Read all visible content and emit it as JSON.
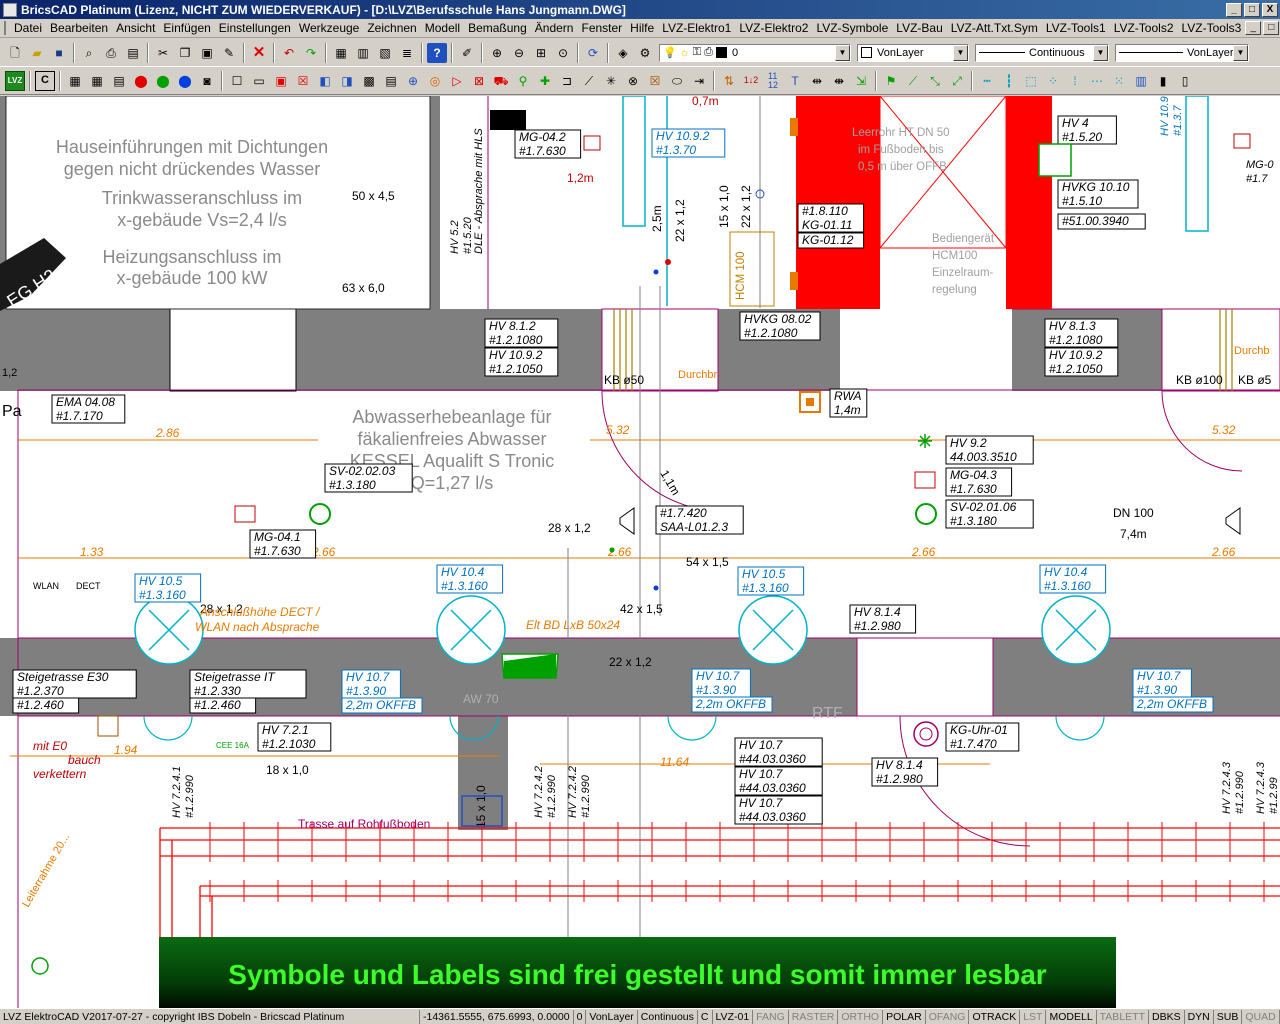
{
  "window": {
    "title": "BricsCAD Platinum (Lizenz, NICHT ZUM WIEDERVERKAUF) - [D:\\LVZ\\Berufsschule Hans Jungmann.DWG]",
    "min": "_",
    "max": "□",
    "close": "X"
  },
  "menu": [
    "Datei",
    "Bearbeiten",
    "Ansicht",
    "Einfügen",
    "Einstellungen",
    "Werkzeuge",
    "Zeichnen",
    "Modell",
    "Bemaßung",
    "Ändern",
    "Fenster",
    "Hilfe",
    "LVZ-Elektro1",
    "LVZ-Elektro2",
    "LVZ-Symbole",
    "LVZ-Bau",
    "LVZ-Att.Txt.Sym",
    "LVZ-Tools1",
    "LVZ-Tools2",
    "LVZ-Tools3"
  ],
  "properties": {
    "layer": "0",
    "color": "VonLayer",
    "linetype": "Continuous",
    "lineweight": "VonLayer"
  },
  "toolbar2": {
    "lvz_label": "LVZ",
    "c_label": "C"
  },
  "drawing": {
    "notes": [
      "Hauseinführungen mit Dichtungen",
      "gegen nicht drückendes Wasser",
      "Trinkwasseranschluss im",
      "x-gebäude Vs=2,4 l/s",
      "Heizungsanschluss  im",
      "x-gebäude 100 kW",
      "Abwasserhebeanlage für",
      "fäkalienfreies Abwasser",
      "KESSEL Aqualift S Tronic",
      "Q=1,27 l/s"
    ],
    "dims": [
      "50 x 4,5",
      "63 x 6,0",
      "2.86",
      "1.33",
      "2.66",
      "5.32",
      "28 x 1,2",
      "54 x 1,5",
      "42 x 1,5",
      "22 x 1,2",
      "18 x 1,0",
      "1.94",
      "11.64",
      "0,7m",
      "1,2m",
      "2,5m",
      "22 x 1,2",
      "15 x 1,0",
      "22 x 1,2",
      "1,1m",
      "DN 100",
      "7,4m",
      "15 x 1,0"
    ],
    "labels": [
      {
        "l1": "MG-04.2",
        "l2": "#1.7.630"
      },
      {
        "l1": "HV 10.9.2",
        "l2": "#1.3.70"
      },
      {
        "l1": "HV 4",
        "l2": "#1.5.20"
      },
      {
        "l1": "HVKG 10.10",
        "l2": "#1.5.10"
      },
      {
        "l1": "#51.00.3940",
        "l2": ""
      },
      {
        "l1": "#1.8.110",
        "l2": "KG-01.11"
      },
      {
        "l1": "KG-01.12",
        "l2": ""
      },
      {
        "l1": "HV 8.1.2",
        "l2": "#1.2.1080"
      },
      {
        "l1": "HV 10.9.2",
        "l2": "#1.2.1050"
      },
      {
        "l1": "HVKG 08.02",
        "l2": "#1.2.1080"
      },
      {
        "l1": "HV 8.1.3",
        "l2": "#1.2.1080"
      },
      {
        "l1": "HV 10.9.2",
        "l2": "#1.2.1050"
      },
      {
        "l1": "EMA 04.08",
        "l2": "#1.7.170"
      },
      {
        "l1": "RWA",
        "l2": "1,4m"
      },
      {
        "l1": "HV 9.2",
        "l2": "44.003.3510"
      },
      {
        "l1": "MG-04.3",
        "l2": "#1.7.630"
      },
      {
        "l1": "SV-02.02.03",
        "l2": "#1.3.180"
      },
      {
        "l1": "SV-02.01.06",
        "l2": "#1.3.180"
      },
      {
        "l1": "#1.7.420",
        "l2": "SAA-L01.2.3"
      },
      {
        "l1": "MG-04.1",
        "l2": "#1.7.630"
      },
      {
        "l1": "HV 10.5",
        "l2": "#1.3.160"
      },
      {
        "l1": "HV 10.4",
        "l2": "#1.3.160"
      },
      {
        "l1": "HV 10.5",
        "l2": "#1.3.160"
      },
      {
        "l1": "HV 10.4",
        "l2": "#1.3.160"
      },
      {
        "l1": "HV 8.1.4",
        "l2": "#1.2.980"
      },
      {
        "l1": "Steigetrasse E30",
        "l2": "#1.2.370"
      },
      {
        "l1": "#1.2.460",
        "l2": ""
      },
      {
        "l1": "Steigetrasse IT",
        "l2": "#1.2.330"
      },
      {
        "l1": "#1.2.460",
        "l2": ""
      },
      {
        "l1": "HV 7.2.1",
        "l2": "#1.2.1030"
      },
      {
        "l1": "HV 10.7",
        "l2": "#1.3.90"
      },
      {
        "l1": "2,2m OKFFB",
        "l2": ""
      },
      {
        "l1": "HV 10.7",
        "l2": "#1.3.90"
      },
      {
        "l1": "2,2m OKFFB",
        "l2": ""
      },
      {
        "l1": "HV 10.7",
        "l2": "#1.3.90"
      },
      {
        "l1": "2,2m OKFFB",
        "l2": ""
      },
      {
        "l1": "KG-Uhr-01",
        "l2": "#1.7.470"
      },
      {
        "l1": "HV 8.1.4",
        "l2": "#1.2.980"
      },
      {
        "l1": "HV 10.7",
        "l2": "#44.03.0360"
      },
      {
        "l1": "HV 10.7",
        "l2": "#44.03.0360"
      },
      {
        "l1": "HV 10.7",
        "l2": "#44.03.0360"
      }
    ],
    "misc_text": [
      "EG.H2",
      "Pa",
      "1,2",
      "WLAN",
      "DECT",
      "Anschlußhöhe DECT /",
      "WLAN nach Absprache",
      "Elt BD LxB 50x24",
      "AW 70",
      "RTF",
      "Trasse auf Rohfußboden",
      "mit E0",
      "bauch",
      "verkettern",
      "KB ø50",
      "KB ø100",
      "KB ø5",
      "Durchbr",
      "Durchb",
      "Leerrohr HT DN 50",
      "im Fußboden bis",
      "0,5 m über OFFB",
      "Bediengerät",
      "HCM100",
      "Einzelraum-",
      "regelung",
      "HCM 100",
      "HV 5.2",
      "#1.5.20",
      "DLE - Absprache mit HLS",
      "E",
      "HV 10.9",
      "#1.3.7",
      "MG-0",
      "#1.7",
      "HV 7.2.4.1",
      "#1.2.990",
      "HV 7.2.4.2",
      "#1.2.990",
      "HV 7.2.4.2",
      "#1.2.990",
      "HV 7.2.4.3",
      "#1.2.990",
      "HV 7.2.4.3",
      "#1.2.99",
      "CEE 16A",
      "Leiterrahme 20..."
    ]
  },
  "banner": "Symbole und Labels sind frei gestellt und somit immer lesbar",
  "status": {
    "left": "LVZ ElektroCAD V2017-07-27 - copyright IBS Dobeln - Bricscad Platinum",
    "coords": "-14361.5555, 675.6993, 0.0000",
    "layer": "0",
    "color": "VonLayer",
    "linetype": "Continuous",
    "c": "C",
    "current": "LVZ-01",
    "toggles": [
      {
        "label": "FANG",
        "on": false
      },
      {
        "label": "RASTER",
        "on": false
      },
      {
        "label": "ORTHO",
        "on": false
      },
      {
        "label": "POLAR",
        "on": true
      },
      {
        "label": "OFANG",
        "on": false
      },
      {
        "label": "OTRACK",
        "on": true
      },
      {
        "label": "LST",
        "on": false
      },
      {
        "label": "MODELL",
        "on": true
      },
      {
        "label": "TABLETT",
        "on": false
      },
      {
        "label": "DBKS",
        "on": true
      },
      {
        "label": "DYN",
        "on": true
      },
      {
        "label": "SUB",
        "on": true
      },
      {
        "label": "QUAD",
        "on": false
      }
    ]
  },
  "colors": {
    "dim_orange": "#e87a00",
    "label_blue": "#0070c0",
    "wall_gray": "#7f7f7f",
    "red": "#ff0000",
    "green": "#00a000",
    "magenta": "#a0006a",
    "cyan": "#00b4c8"
  }
}
